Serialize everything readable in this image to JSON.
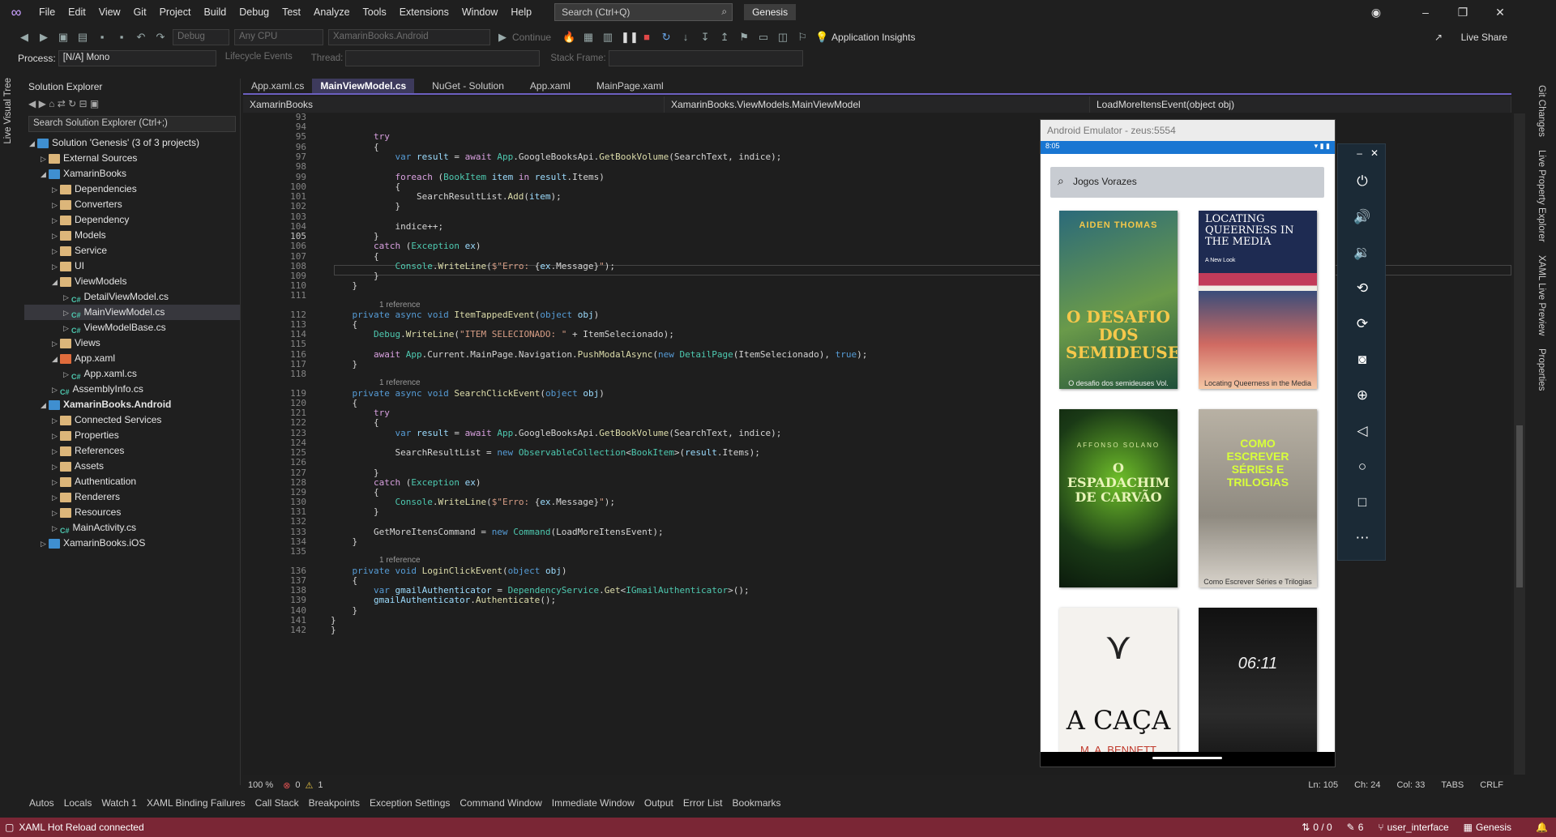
{
  "menu": [
    "File",
    "Edit",
    "View",
    "Git",
    "Project",
    "Build",
    "Debug",
    "Test",
    "Analyze",
    "Tools",
    "Extensions",
    "Window",
    "Help"
  ],
  "search": {
    "placeholder": "Search (Ctrl+Q)"
  },
  "solution_name": "Genesis",
  "toolbar": {
    "config": "Debug",
    "platform": "Any CPU",
    "startup": "XamarinBooks.Android",
    "continue": "Continue",
    "app_insights": "Application Insights",
    "live_share": "Live Share"
  },
  "toolbar2": {
    "process_label": "Process:",
    "process_value": "[N/A] Mono",
    "lifecycle": "Lifecycle Events",
    "thread": "Thread:",
    "stack_frame": "Stack Frame:"
  },
  "left_rail": "Live Visual Tree",
  "right_rail": [
    "Git Changes",
    "Live Property Explorer",
    "XAML Live Preview",
    "Properties"
  ],
  "solution_explorer": {
    "title": "Solution Explorer",
    "search": "Search Solution Explorer (Ctrl+;)",
    "items": [
      {
        "label": "Solution 'Genesis' (3 of 3 projects)",
        "depth": 0
      },
      {
        "label": "External Sources",
        "depth": 1
      },
      {
        "label": "XamarinBooks",
        "depth": 1
      },
      {
        "label": "Dependencies",
        "depth": 2
      },
      {
        "label": "Converters",
        "depth": 2
      },
      {
        "label": "Dependency",
        "depth": 2
      },
      {
        "label": "Models",
        "depth": 2
      },
      {
        "label": "Service",
        "depth": 2
      },
      {
        "label": "UI",
        "depth": 2
      },
      {
        "label": "ViewModels",
        "depth": 2
      },
      {
        "label": "DetailViewModel.cs",
        "depth": 3
      },
      {
        "label": "MainViewModel.cs",
        "depth": 3
      },
      {
        "label": "ViewModelBase.cs",
        "depth": 3
      },
      {
        "label": "Views",
        "depth": 2
      },
      {
        "label": "App.xaml",
        "depth": 2
      },
      {
        "label": "App.xaml.cs",
        "depth": 3
      },
      {
        "label": "AssemblyInfo.cs",
        "depth": 2
      },
      {
        "label": "XamarinBooks.Android",
        "depth": 1
      },
      {
        "label": "Connected Services",
        "depth": 2
      },
      {
        "label": "Properties",
        "depth": 2
      },
      {
        "label": "References",
        "depth": 2
      },
      {
        "label": "Assets",
        "depth": 2
      },
      {
        "label": "Authentication",
        "depth": 2
      },
      {
        "label": "Renderers",
        "depth": 2
      },
      {
        "label": "Resources",
        "depth": 2
      },
      {
        "label": "MainActivity.cs",
        "depth": 2
      },
      {
        "label": "XamarinBooks.iOS",
        "depth": 1
      }
    ]
  },
  "editor_tabs": [
    "App.xaml.cs",
    "MainViewModel.cs",
    "NuGet - Solution",
    "App.xaml",
    "MainPage.xaml"
  ],
  "navbar": {
    "project": "XamarinBooks",
    "class": "XamarinBooks.ViewModels.MainViewModel",
    "member": "LoadMoreItensEvent(object obj)"
  },
  "reference_label": "1 reference",
  "line_numbers": [
    "93",
    "94",
    "95",
    "96",
    "97",
    "98",
    "99",
    "100",
    "101",
    "102",
    "103",
    "104",
    "105",
    "106",
    "107",
    "108",
    "109",
    "110",
    "111",
    "112",
    "113",
    "114",
    "115",
    "116",
    "117",
    "118",
    "119",
    "120",
    "121",
    "122",
    "123",
    "124",
    "125",
    "126",
    "127",
    "128",
    "129",
    "130",
    "131",
    "132",
    "133",
    "134",
    "135",
    "136",
    "137",
    "138",
    "139",
    "140",
    "141",
    "142"
  ],
  "emulator": {
    "title": "Android Emulator - zeus:5554",
    "time": "8:05",
    "search_text": "Jogos Vorazes",
    "books": [
      {
        "cover_author": "AIDEN THOMAS",
        "cover_title": "O DESAFIO DOS SEMIDEUSES",
        "caption": "O desafio dos semideuses Vol."
      },
      {
        "cover_title": "LOCATING QUEERNESS IN THE MEDIA",
        "cover_subtitle": "A New Look",
        "caption": "Locating Queerness in the Media"
      },
      {
        "cover_author": "AFFONSO SOLANO",
        "cover_title": "O ESPADACHIM DE CARVÃO",
        "caption": ""
      },
      {
        "cover_title": "COMO ESCREVER SÉRIES E TRILOGIAS",
        "caption": "Como Escrever Séries e Trilogias"
      },
      {
        "cover_title": "A CAÇA",
        "cover_author": "M. A. BENNETT",
        "caption": ""
      },
      {
        "cover_title": "06:11",
        "caption": ""
      }
    ]
  },
  "bottom_tabs": [
    "Autos",
    "Locals",
    "Watch 1",
    "XAML Binding Failures",
    "Call Stack",
    "Breakpoints",
    "Exception Settings",
    "Command Window",
    "Immediate Window",
    "Output",
    "Error List",
    "Bookmarks"
  ],
  "editor_status": {
    "zoom": "100 %",
    "errors": "0",
    "warnings": "1",
    "ln": "Ln: 105",
    "ch": "Ch: 24",
    "col": "Col: 33",
    "tabs": "TABS",
    "eol": "CRLF"
  },
  "status": {
    "message": "XAML Hot Reload connected",
    "changes": "0 / 0",
    "edits": "6",
    "branch": "user_interface",
    "repo": "Genesis"
  },
  "colors": {
    "accent": "#6b5fbf",
    "statusbar": "#7a2635",
    "android_blue": "#1976d2"
  }
}
